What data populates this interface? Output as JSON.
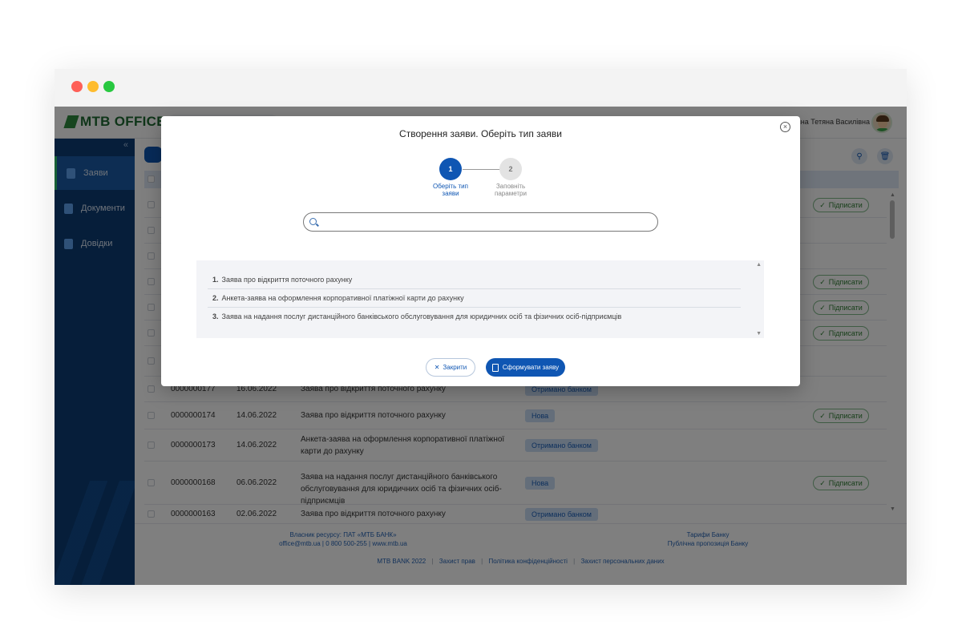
{
  "app": {
    "logo_text": "MTB OFFICE",
    "user_name": "ішина Тетяна Василівна"
  },
  "sidebar": {
    "collapse_glyph": "«",
    "items": [
      {
        "label": "Заяви",
        "active": true
      },
      {
        "label": "Документи",
        "active": false
      },
      {
        "label": "Довідки",
        "active": false
      }
    ]
  },
  "table": {
    "sign_label": "Підписати",
    "rows": [
      {
        "number": "",
        "date": "",
        "name": "",
        "status": "",
        "sign": true
      },
      {
        "number": "",
        "date": "",
        "name": "",
        "status": "",
        "sign": false
      },
      {
        "number": "",
        "date": "",
        "name": "",
        "status": "",
        "sign": false
      },
      {
        "number": "",
        "date": "",
        "name": "",
        "status": "",
        "sign": true
      },
      {
        "number": "",
        "date": "",
        "name": "",
        "status": "",
        "sign": true
      },
      {
        "number": "",
        "date": "",
        "name": "",
        "status": "",
        "sign": true
      },
      {
        "number": "",
        "date": "",
        "name": "",
        "status": "",
        "sign": false
      },
      {
        "number": "0000000177",
        "date": "16.06.2022",
        "name": "Заява про відкриття поточного рахунку",
        "status": "Отримано банком",
        "sign": false
      },
      {
        "number": "0000000174",
        "date": "14.06.2022",
        "name": "Заява про відкриття поточного рахунку",
        "status": "Нова",
        "sign": true
      },
      {
        "number": "0000000173",
        "date": "14.06.2022",
        "name": "Анкета-заява на оформлення корпоративної платіжної карти до рахунку",
        "status": "Отримано банком",
        "sign": false
      },
      {
        "number": "0000000168",
        "date": "06.06.2022",
        "name": "Заява на надання послуг дистанційного банківського обслуговування для юридичних осіб та фізичних осіб-підприємців",
        "status": "Нова",
        "sign": true
      },
      {
        "number": "0000000163",
        "date": "02.06.2022",
        "name": "Заява про відкриття поточного рахунку",
        "status": "Отримано банком",
        "sign": false
      }
    ]
  },
  "footer": {
    "owner_line": "Власник ресурсу: ПАТ «МТБ БАНК»",
    "contacts_line": "office@mtb.ua | 0 800 500-255 | www.mtb.ua",
    "tariffs": "Тарифи Банку",
    "public_offer": "Публічна пропозиція Банку",
    "copyright": "MTB BANK 2022",
    "links": [
      "Захист прав",
      "Політика конфіденційності",
      "Захист персональних даних"
    ]
  },
  "modal": {
    "title": "Створення заяви. Оберіть тип заяви",
    "close_glyph": "×",
    "steps": [
      {
        "number": "1",
        "label_line1": "Оберіть тип",
        "label_line2": "заяви",
        "active": true
      },
      {
        "number": "2",
        "label_line1": "Заповніть",
        "label_line2": "параметри",
        "active": false
      }
    ],
    "search": {
      "value": "",
      "placeholder": ""
    },
    "options": [
      {
        "num": "1.",
        "label": "Заява про відкриття поточного рахунку"
      },
      {
        "num": "2.",
        "label": "Анкета-заява на оформлення корпоративної платіжної карти до рахунку"
      },
      {
        "num": "3.",
        "label": "Заява на надання послуг дистанційного банківського обслуговування для юридичних осіб та фізичних осіб-підприємців"
      }
    ],
    "close_button": "Закрити",
    "submit_button": "Сформувати заяву"
  },
  "colors": {
    "primary": "#0f56b3",
    "sidebar": "#0d3d75",
    "accent_green": "#2fc06b"
  }
}
